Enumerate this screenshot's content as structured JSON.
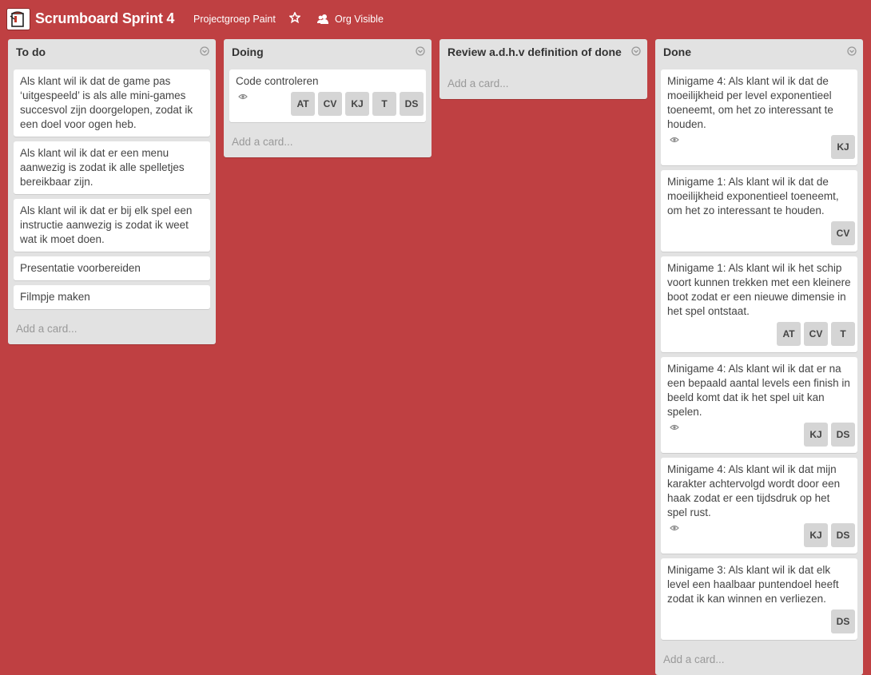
{
  "header": {
    "board_title": "Scrumboard Sprint 4",
    "org_name": "Projectgroep Paint",
    "star_icon": "star-icon",
    "visibility_label": "Org Visible",
    "colors": {
      "background": "#bf4042",
      "list": "#e2e2e2",
      "card": "#ffffff",
      "member": "#d5d5d5"
    }
  },
  "lists": [
    {
      "title": "To do",
      "add_card": "Add a card...",
      "cards": [
        {
          "text": "Als klant wil ik dat de game pas ‘uitgespeeld’ is als alle mini-games succesvol zijn doorgelopen, zodat ik een doel voor ogen heb."
        },
        {
          "text": "Als klant wil ik dat er een menu aanwezig is zodat ik alle spelletjes bereikbaar zijn."
        },
        {
          "text": "Als klant wil ik dat er bij elk spel een instructie aanwezig is zodat ik weet wat ik moet doen."
        },
        {
          "text": "Presentatie voorbereiden"
        },
        {
          "text": "Filmpje maken"
        }
      ]
    },
    {
      "title": "Doing",
      "add_card": "Add a card...",
      "cards": [
        {
          "text": "Code controleren",
          "watched": true,
          "members": [
            "AT",
            "CV",
            "KJ",
            "T",
            "DS"
          ]
        }
      ]
    },
    {
      "title": "Review a.d.h.v definition of done",
      "add_card": "Add a card...",
      "cards": []
    },
    {
      "title": "Done",
      "add_card": "Add a card...",
      "cards": [
        {
          "text": "Minigame 4: Als klant wil ik dat de moeilijkheid per level exponentieel toeneemt, om het zo interessant te houden.",
          "watched": true,
          "members": [
            "KJ"
          ]
        },
        {
          "text": "Minigame 1: Als klant wil ik dat de moeilijkheid exponentieel toeneemt, om het zo interessant te houden.",
          "members": [
            "CV"
          ]
        },
        {
          "text": "Minigame 1: Als klant wil ik het schip voort kunnen trekken met een kleinere boot zodat er een nieuwe dimensie in het spel ontstaat.",
          "members": [
            "AT",
            "CV",
            "T"
          ]
        },
        {
          "text": "Minigame 4: Als klant wil ik dat er na een bepaald aantal levels een finish in beeld komt dat ik het spel uit kan spelen.",
          "watched": true,
          "members": [
            "KJ",
            "DS"
          ]
        },
        {
          "text": "Minigame 4: Als klant wil ik dat mijn karakter achtervolgd wordt door een haak zodat er een tijdsdruk op het spel rust.",
          "watched": true,
          "members": [
            "KJ",
            "DS"
          ]
        },
        {
          "text": "Minigame 3: Als klant wil ik dat elk level een haalbaar puntendoel heeft zodat ik kan winnen en verliezen.",
          "members": [
            "DS"
          ]
        }
      ]
    }
  ]
}
